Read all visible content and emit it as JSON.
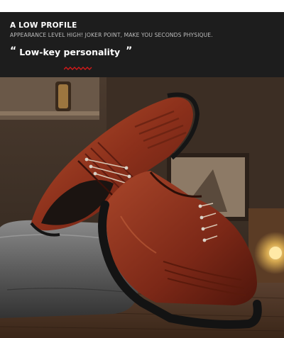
{
  "header": {
    "title": "A LOW PROFILE",
    "subtitle": "APPEARANCE LEVEL HIGH! JOKER POINT, MAKE YOU SECONDS PHYSIQUE.",
    "quote_open": "“",
    "tagline": "Low-key personality",
    "quote_close": "”"
  },
  "colors": {
    "banner": "#1d1d1d",
    "accent_zigzag": "#d11a1a",
    "leather": "#8a2f1c",
    "sole": "#1a1a1a"
  },
  "icons": [
    "zigzag-divider-icon"
  ]
}
